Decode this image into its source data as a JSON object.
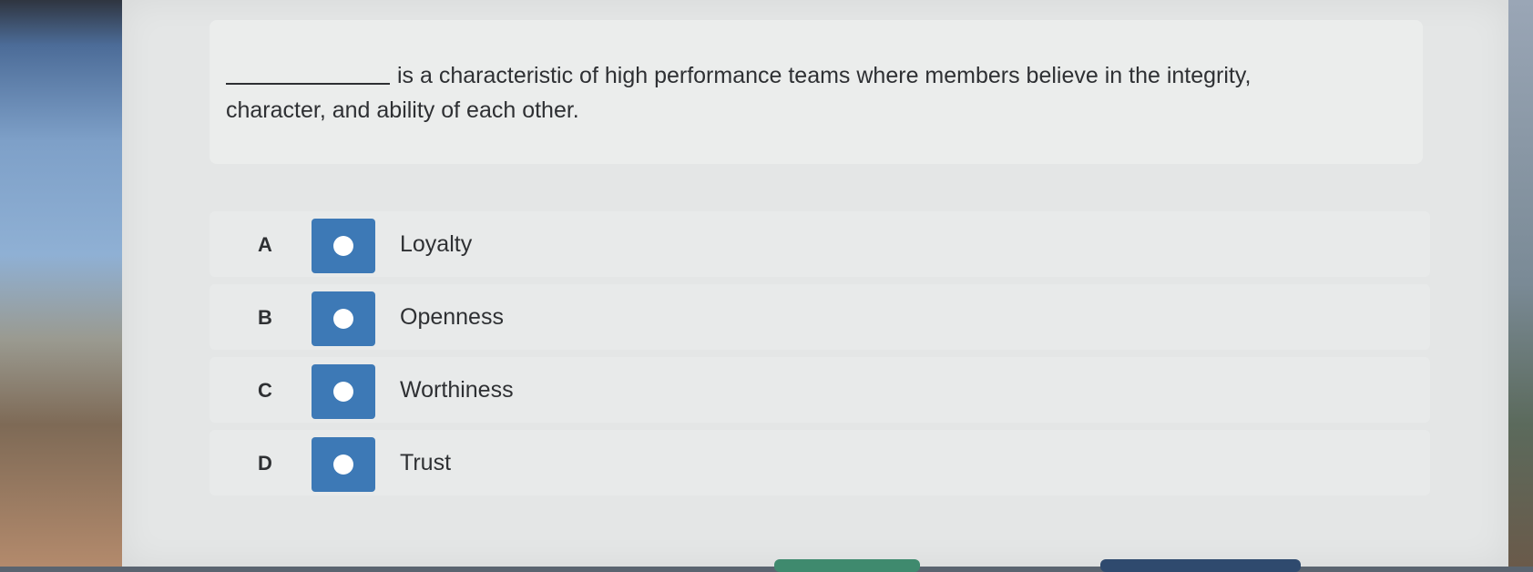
{
  "question": {
    "blank": "",
    "text": "is a characteristic of high performance teams where members believe in the integrity, character, and ability of each other."
  },
  "options": [
    {
      "letter": "A",
      "label": "Loyalty"
    },
    {
      "letter": "B",
      "label": "Openness"
    },
    {
      "letter": "C",
      "label": "Worthiness"
    },
    {
      "letter": "D",
      "label": "Trust"
    }
  ],
  "colors": {
    "radio_fill": "#3d79b6",
    "bottom_left_button": "#3f8a6e",
    "bottom_right_button": "#2f4a6e"
  },
  "icons": {
    "radio": "radio-circle-icon"
  }
}
